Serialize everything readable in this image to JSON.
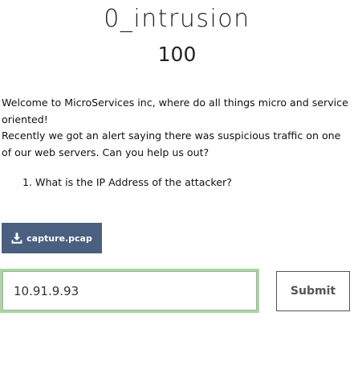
{
  "challenge": {
    "name": "0_intrusion",
    "value": "100"
  },
  "description": {
    "paragraph": "Welcome to MicroServices inc, where do all things micro and service oriented!",
    "paragraph2": "Recently we got an alert saying there was suspicious traffic on one of our web servers. Can you help us out?",
    "questions": [
      "1. What is the IP Address of the attacker?"
    ]
  },
  "file_download": {
    "label": "capture.pcap",
    "icon": "download-icon",
    "color": "#4b5f80"
  },
  "flag_input": {
    "value": "10.91.9.93",
    "focus_border_color": "#a8d8a0"
  },
  "submit": {
    "label": "Submit"
  }
}
